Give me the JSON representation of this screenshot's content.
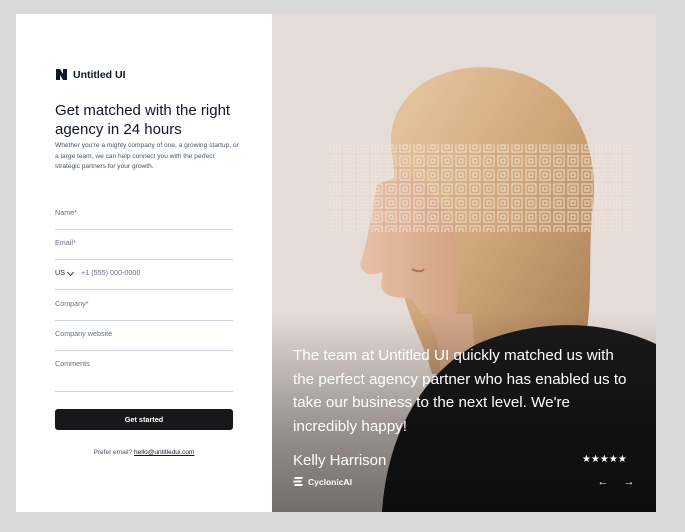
{
  "brand": {
    "name": "Untitled UI"
  },
  "form": {
    "title": "Get matched with the right agency in 24 hours",
    "subtitle": "Whether you're a mighty company of one, a growing startup, or a large team, we can help connect you with the perfect strategic partners for your growth.",
    "fields": {
      "name": "Name*",
      "email": "Email*",
      "phone_country": "US",
      "phone_placeholder": "+1 (555) 000-0000",
      "company": "Company*",
      "website": "Company website",
      "comments": "Comments"
    },
    "submit_label": "Get started",
    "alt_prefix": "Prefer email?",
    "alt_email": "hello@untitledui.com"
  },
  "testimonial": {
    "quote": "The team at Untitled UI quickly matched us with the perfect agency partner who has enabled us to take our business to the next level. We're incredibly happy!",
    "author": "Kelly Harrison",
    "company": "CyclonicAI",
    "rating": 5,
    "stars_text": "★★★★★",
    "prev_arrow": "←",
    "next_arrow": "→"
  },
  "colors": {
    "button_bg": "#18181b",
    "text_primary": "#101828",
    "text_secondary": "#475467",
    "border": "#d0d5dd"
  }
}
